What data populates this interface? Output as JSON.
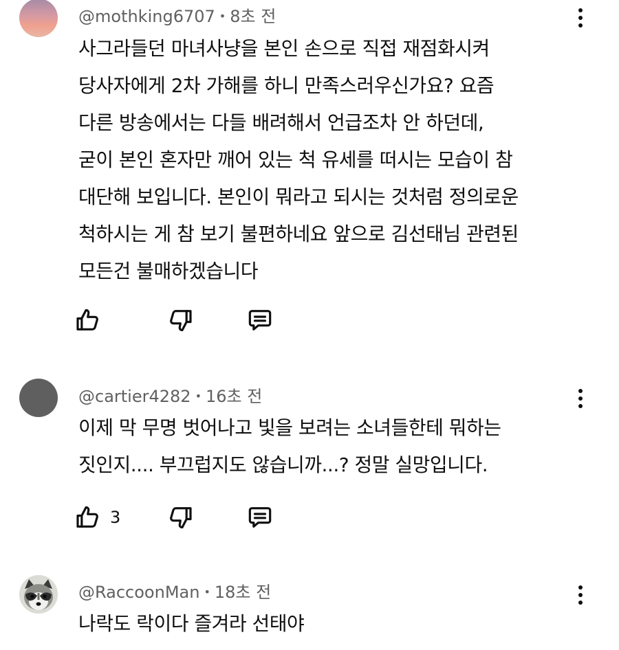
{
  "comments": [
    {
      "author": "@mothking6707",
      "time": "8초 전",
      "text": "사그라들던 마녀사냥을 본인 손으로 직접 재점화시켜\n당사자에게 2차 가해를 하니 만족스러우신가요? 요즘\n다른 방송에서는 다들 배려해서 언급조차 안 하던데,\n굳이 본인 혼자만 깨어 있는 척 유세를 떠시는 모습이 참\n대단해 보입니다. 본인이 뭐라고 되시는 것처럼 정의로운\n척하시는 게 참 보기 불편하네요 앞으로 김선태님 관련된\n모든건 불매하겠습니다",
      "likes": "",
      "avatar": "sunset-gradient-avatar"
    },
    {
      "author": "@cartier4282",
      "time": "16초 전",
      "text": "이제 막 무명 벗어나고 빛을 보려는 소녀들한테 뭐하는\n짓인지.... 부끄럽지도 않습니까...? 정말 실망입니다.",
      "likes": "3",
      "avatar": "gray-default-avatar"
    },
    {
      "author": "@RaccoonMan",
      "time": "18초 전",
      "text": "나락도 락이다 즐겨라 선태야",
      "likes": "",
      "avatar": "raccoon-photo-avatar"
    }
  ],
  "icons": {
    "like": "thumbs-up-icon",
    "dislike": "thumbs-down-icon",
    "reply": "reply-comment-icon",
    "more": "more-vertical-icon"
  },
  "colors": {
    "text": "#0f0f0f",
    "meta": "#606060",
    "background": "#ffffff"
  }
}
